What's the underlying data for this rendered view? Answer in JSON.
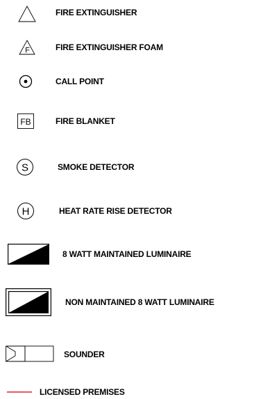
{
  "legend": {
    "items": [
      {
        "icon": "triangle-icon",
        "label": "FIRE EXTINGUISHER"
      },
      {
        "icon": "triangle-f-icon",
        "label": "FIRE EXTINGUISHER FOAM",
        "symbol_text": "F"
      },
      {
        "icon": "circle-dot-icon",
        "label": "CALL POINT"
      },
      {
        "icon": "square-fb-icon",
        "label": "FIRE BLANKET",
        "symbol_text": "FB"
      },
      {
        "icon": "circle-s-icon",
        "label": "SMOKE DETECTOR",
        "symbol_text": "S"
      },
      {
        "icon": "circle-h-icon",
        "label": "HEAT RATE RISE DETECTOR",
        "symbol_text": "H"
      },
      {
        "icon": "luminaire-icon",
        "label": "8 WATT MAINTAINED LUMINAIRE"
      },
      {
        "icon": "double-box-luminaire-icon",
        "label": "NON MAINTAINED 8 WATT LUMINAIRE"
      },
      {
        "icon": "sounder-icon",
        "label": "SOUNDER"
      },
      {
        "icon": "red-line-icon",
        "label": "LICENSED PREMISES"
      }
    ],
    "colors": {
      "line": "#000000",
      "licensed_premises": "#e0242c"
    }
  }
}
